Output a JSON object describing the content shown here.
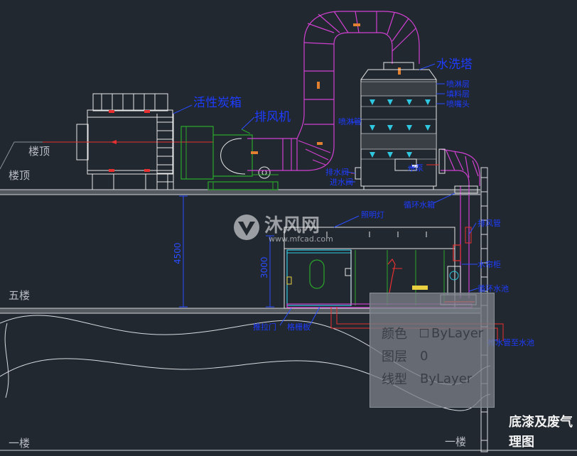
{
  "floors": {
    "roof_top": "楼顶",
    "roof": "楼顶",
    "fifth": "五楼",
    "first_left": "一楼",
    "first_right": "一楼"
  },
  "equipment_labels": {
    "carbon_box": "活性炭箱",
    "exhaust_fan": "排风机",
    "water_tower": "水洗塔",
    "tower_anno1": "喷淋层",
    "tower_anno2": "填料层",
    "tower_anno3": "喷嘴头",
    "tower_side": "喷淋管",
    "tower_pump": "水泵",
    "drain_valve": "排水阀",
    "inlet_valve": "进水阀",
    "water_tank": "循环水箱",
    "lamp": "照明灯",
    "exhaust_pipe": "排风管",
    "spray_pump": "水帘柜",
    "circulating_pool": "循环水池",
    "sliding_door": "推拉门",
    "grille": "格栅板",
    "outlet": "排水管至水池"
  },
  "dimensions": {
    "height_4500": "4500",
    "height_3000": "3000"
  },
  "title": {
    "line1": "底漆及废气",
    "line2": "理图"
  },
  "watermark": {
    "brand": "沐风网",
    "url": "www.mfcad.com"
  },
  "tooltip": {
    "color_label": "颜色",
    "color_value": "ByLayer",
    "layer_label": "图层",
    "layer_value": "0",
    "linetype_label": "线型",
    "linetype_value": "ByLayer"
  },
  "colors": {
    "background": "#212830",
    "duct": "#d040d0",
    "equipment": "#e8e8e8",
    "fan": "#2aa82a",
    "label": "#1e3cff",
    "air_red": "#e83030",
    "water_cyan": "#30c8e0"
  }
}
